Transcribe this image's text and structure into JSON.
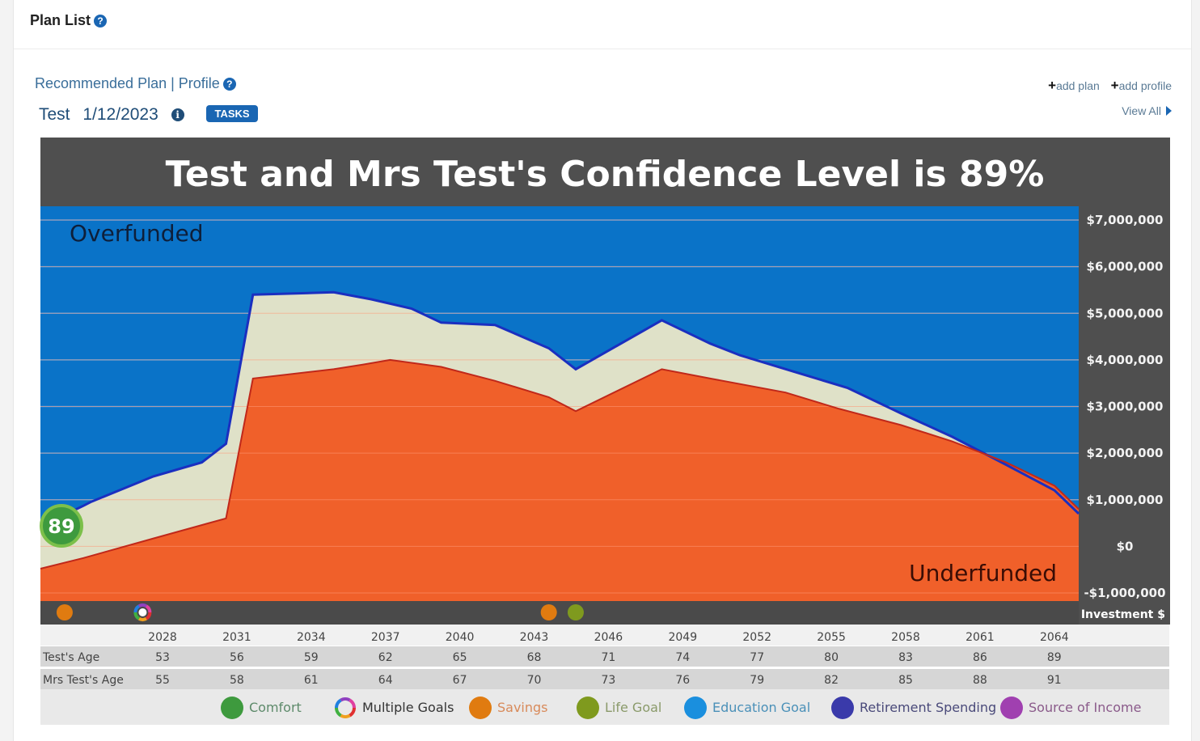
{
  "header": {
    "title": "Plan List"
  },
  "plan": {
    "recommended_label": "Recommended Plan | Profile",
    "name": "Test",
    "date": "1/12/2023",
    "tasks_label": "TASKS"
  },
  "links": {
    "add_plan": "add plan",
    "add_profile": "add profile",
    "view_all": "View All"
  },
  "confidence_badge": "89",
  "chart_data": {
    "type": "area",
    "title": "Test and Mrs Test's Confidence Level is 89%",
    "ylabel": "Investment $",
    "xlabel": "",
    "ylim": [
      -1000000,
      7000000
    ],
    "xlim": [
      2026.4,
      2065
    ],
    "yticks": [
      7000000,
      6000000,
      5000000,
      4000000,
      3000000,
      2000000,
      1000000,
      0,
      -1000000
    ],
    "ytick_labels": [
      "$7,000,000",
      "$6,000,000",
      "$5,000,000",
      "$4,000,000",
      "$3,000,000",
      "$2,000,000",
      "$1,000,000",
      "$0",
      "-$1,000,000"
    ],
    "xticks": [
      "2028",
      "2031",
      "2034",
      "2037",
      "2040",
      "2043",
      "2046",
      "2049",
      "2052",
      "2055",
      "2058",
      "2061",
      "2064"
    ],
    "region_labels": {
      "top": "Overfunded",
      "bottom": "Underfunded"
    },
    "grid": true,
    "series": [
      {
        "name": "Upper bound (overfunded threshold)",
        "color": "#1a2fc0",
        "x": [
          2026.4,
          2028.0,
          2028.3,
          2030.6,
          2032.4,
          2033.3,
          2034.3,
          2037.3,
          2038.7,
          2040.2,
          2041.3,
          2043.3,
          2045.3,
          2046.3,
          2049.5,
          2051.3,
          2052.4,
          2054.4,
          2056.4,
          2058.4,
          2060.3,
          2062.3,
          2064.1,
          2065.0
        ],
        "values": [
          430000,
          870000,
          960000,
          1500000,
          1800000,
          2200000,
          5400000,
          5450000,
          5300000,
          5100000,
          4800000,
          4750000,
          4250000,
          3800000,
          4850000,
          4350000,
          4100000,
          3750000,
          3400000,
          2850000,
          2350000,
          1750000,
          1200000,
          700000
        ]
      },
      {
        "name": "Lower bound (underfunded threshold)",
        "color": "#c0281a",
        "x": [
          2026.4,
          2028.0,
          2030.6,
          2033.3,
          2034.3,
          2037.3,
          2038.4,
          2039.4,
          2041.3,
          2043.3,
          2045.3,
          2046.3,
          2049.5,
          2051.3,
          2054.1,
          2056.1,
          2058.4,
          2060.3,
          2062.3,
          2064.1,
          2065.0
        ],
        "values": [
          -480000,
          -250000,
          170000,
          600000,
          3600000,
          3800000,
          3900000,
          4000000,
          3850000,
          3550000,
          3200000,
          2900000,
          3800000,
          3600000,
          3300000,
          2950000,
          2600000,
          2250000,
          1800000,
          1300000,
          800000,
          0
        ]
      }
    ],
    "goal_markers": [
      {
        "year": 2027.3,
        "type": "Savings",
        "color": "#e07b10"
      },
      {
        "year": 2030.2,
        "type": "Multiple Goals",
        "color": "multi"
      },
      {
        "year": 2045.3,
        "type": "Savings",
        "color": "#e07b10"
      },
      {
        "year": 2046.3,
        "type": "Life Goal",
        "color": "#7f9a1e"
      }
    ]
  },
  "age_table": {
    "rows": [
      {
        "label": "Test's Age",
        "values": [
          "53",
          "56",
          "59",
          "62",
          "65",
          "68",
          "71",
          "74",
          "77",
          "80",
          "83",
          "86",
          "89"
        ]
      },
      {
        "label": "Mrs Test's Age",
        "values": [
          "55",
          "58",
          "61",
          "64",
          "67",
          "70",
          "73",
          "76",
          "79",
          "82",
          "85",
          "88",
          "91"
        ]
      }
    ]
  },
  "legend": [
    {
      "label": "Comfort",
      "color": "#3e9a3e",
      "text_color": "#5d8a6a"
    },
    {
      "label": "Multiple Goals",
      "color": "multi",
      "text_color": "#333333"
    },
    {
      "label": "Savings",
      "color": "#e07b10",
      "text_color": "#d88a5a"
    },
    {
      "label": "Life Goal",
      "color": "#7f9a1e",
      "text_color": "#8a9a6a"
    },
    {
      "label": "Education Goal",
      "color": "#1a8fde",
      "text_color": "#4a90b8"
    },
    {
      "label": "Retirement Spending",
      "color": "#3a3aaa",
      "text_color": "#4a4a7a"
    },
    {
      "label": "Source of Income",
      "color": "#a040b0",
      "text_color": "#8a5a8a"
    }
  ],
  "colors": {
    "overfunded": "#0a73c8",
    "underfunded": "#f0602a",
    "comfort_zone": "#dfe1c8",
    "chart_frame": "#4f4f4f"
  }
}
